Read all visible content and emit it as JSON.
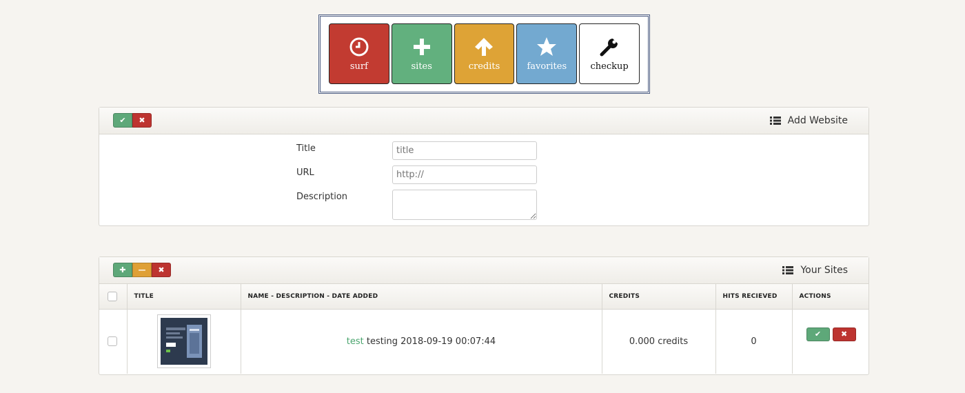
{
  "nav": {
    "surf": "surf",
    "sites": "sites",
    "credits": "credits",
    "favorites": "favorites",
    "checkup": "checkup"
  },
  "add_panel": {
    "title": "Add Website",
    "fields": {
      "title_label": "Title",
      "title_placeholder": "title",
      "url_label": "URL",
      "url_placeholder": "http://",
      "description_label": "Description"
    }
  },
  "sites_panel": {
    "title": "Your Sites",
    "columns": [
      "TITLE",
      "NAME - DESCRIPTION - DATE ADDED",
      "CREDITS",
      "HITS RECIEVED",
      "ACTIONS"
    ],
    "rows": [
      {
        "name": "test",
        "description": "testing",
        "date": "2018-09-19 00:07:44",
        "credits": "0.000 credits",
        "hits": "0"
      }
    ]
  },
  "colors": {
    "surf": "#c23b31",
    "sites": "#62b07e",
    "credits": "#dea336",
    "favorites": "#73a9d0",
    "link": "#4aa56e"
  }
}
